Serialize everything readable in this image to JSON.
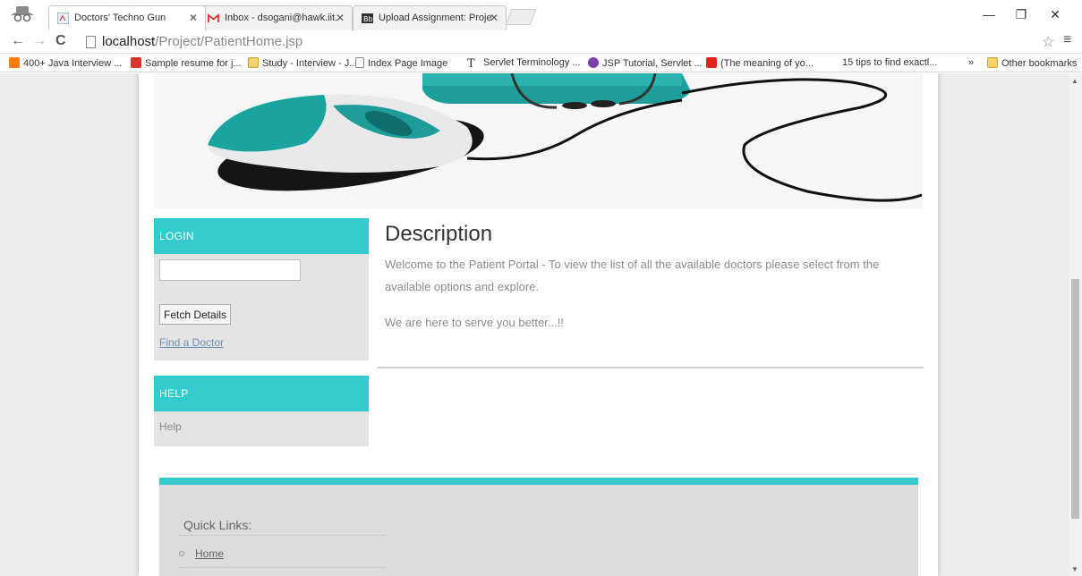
{
  "browser": {
    "tabs": [
      {
        "title": "Doctors' Techno Gun",
        "active": true,
        "icon": "doctor-favicon"
      },
      {
        "title": "Inbox - dsogani@hawk.iit.",
        "active": false,
        "icon": "gmail-icon"
      },
      {
        "title": "Upload Assignment: Proje",
        "active": false,
        "icon": "blackboard-icon"
      }
    ],
    "url_host": "localhost",
    "url_path": "/Project/PatientHome.jsp",
    "bookmarks": [
      {
        "label": "400+ Java Interview ...",
        "icon": "blogger-icon"
      },
      {
        "label": "Sample resume for j...",
        "icon": "red-c-icon"
      },
      {
        "label": "Study - Interview - J...",
        "icon": "folder-icon"
      },
      {
        "label": "Index Page Image",
        "icon": "page-icon"
      },
      {
        "label": "Servlet Terminology ...",
        "icon": "t-icon"
      },
      {
        "label": "JSP Tutorial, Servlet ...",
        "icon": "jsp-icon"
      },
      {
        "label": "(The meaning of yo...",
        "icon": "red-icon"
      },
      {
        "label": "15 tips to find exactl...",
        "icon": "none"
      },
      {
        "label": "»",
        "icon": "none"
      },
      {
        "label": "Other bookmarks",
        "icon": "folder-icon"
      }
    ],
    "colors": {
      "accent": "#35cbcd"
    }
  },
  "page": {
    "login": {
      "heading": "LOGIN",
      "input_value": "",
      "button_label": "Fetch Details",
      "link_label": "Find a Doctor"
    },
    "help": {
      "heading": "HELP",
      "text": "Help"
    },
    "description": {
      "title": "Description",
      "body": "Welcome to the Patient Portal - To view the list of all the available doctors please select from the available options and explore.",
      "tagline": "We are here to serve you better...!!"
    },
    "footer": {
      "quick_links_title": "Quick Links:",
      "links": [
        "Home"
      ]
    }
  }
}
